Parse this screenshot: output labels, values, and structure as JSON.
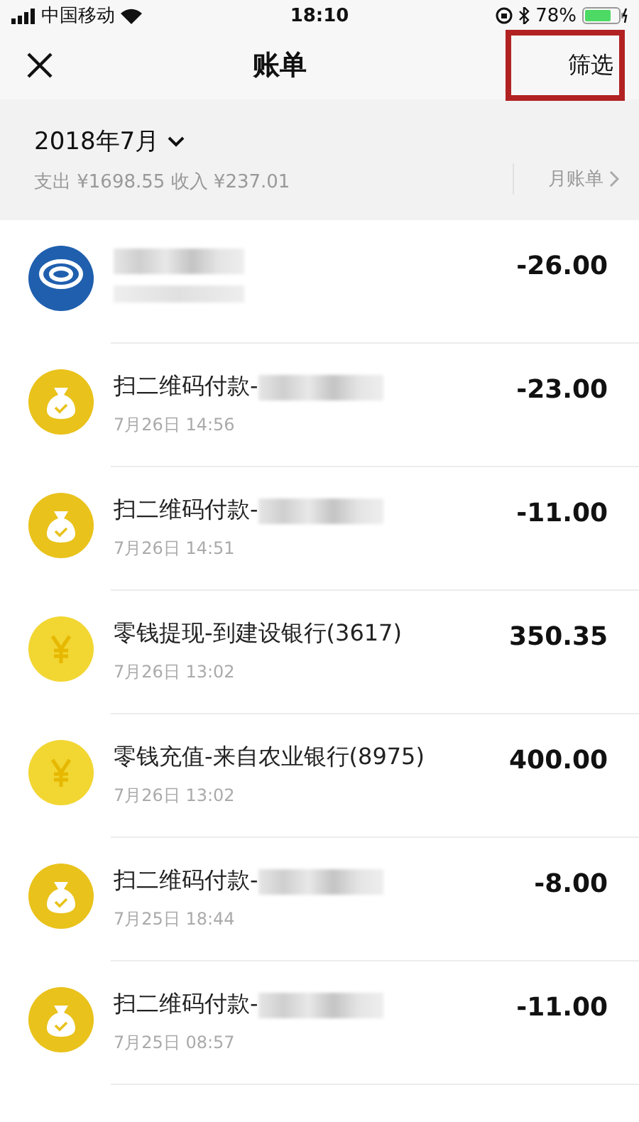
{
  "status_bar": {
    "carrier": "中国移动",
    "time": "18:10",
    "battery": "78%"
  },
  "nav": {
    "title": "账单",
    "filter": "筛选",
    "filter_highlighted": true
  },
  "summary": {
    "month": "2018年7月",
    "totals": "支出 ¥1698.55 收入 ¥237.01",
    "monthly_bill": "月账单"
  },
  "transactions": [
    {
      "kind": "bank",
      "redacted": true,
      "amount": "-26.00"
    },
    {
      "kind": "payment",
      "title": "扫二维码付款-",
      "redacted": true,
      "date": "7月26日 14:56",
      "amount": "-23.00"
    },
    {
      "kind": "payment",
      "title": "扫二维码付款-",
      "redacted": true,
      "date": "7月26日 14:51",
      "amount": "-11.00"
    },
    {
      "kind": "transfer",
      "title": "零钱提现-到建设银行(3617)",
      "redacted": false,
      "date": "7月26日 13:02",
      "amount": "350.35"
    },
    {
      "kind": "transfer",
      "title": "零钱充值-来自农业银行(8975)",
      "redacted": false,
      "date": "7月26日 13:02",
      "amount": "400.00"
    },
    {
      "kind": "payment",
      "title": "扫二维码付款-",
      "redacted": true,
      "date": "7月25日 18:44",
      "amount": "-8.00"
    },
    {
      "kind": "payment",
      "title": "扫二维码付款-",
      "redacted": true,
      "date": "7月25日 08:57",
      "amount": "-11.00"
    }
  ]
}
